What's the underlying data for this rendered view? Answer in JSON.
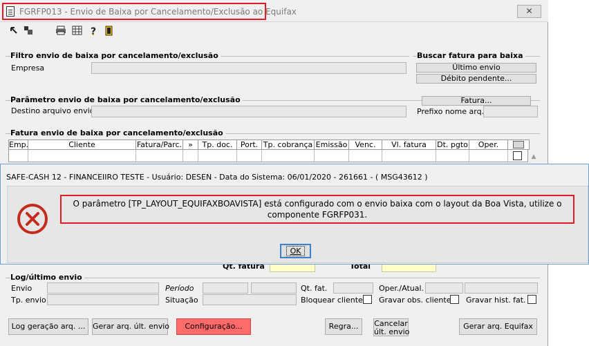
{
  "window": {
    "title": "FGRFP013 - Envio de Baixa por Cancelamento/Exclusão ao Equifax",
    "close_label": "✕"
  },
  "toolbar": {
    "icons": [
      "first-icon",
      "last-icon",
      "print-icon",
      "calculator-icon",
      "help-icon",
      "exit-icon"
    ]
  },
  "filtro": {
    "title": "Filtro envio de baixa por cancelamento/exclusão",
    "empresa_label": "Empresa",
    "empresa_value": ""
  },
  "buscar": {
    "title": "Buscar fatura para baixa",
    "ultimo_envio": "Último envio",
    "debito_pendente": "Débito pendente..."
  },
  "parametro": {
    "title": "Parâmetro envio de baixa por cancelamento/exclusão",
    "destino_label": "Destino arquivo envio",
    "fatura_button": "Fatura...",
    "prefixo_label": "Prefixo nome arq."
  },
  "fatura_grid": {
    "title": "Fatura envio de baixa por cancelamento/exclusão",
    "columns": [
      "Emp.",
      "Cliente",
      "Fatura/Parc.",
      "»",
      "Tp. doc.",
      "Port.",
      "Tp. cobrança",
      "Emissão",
      "Venc.",
      "Vl. fatura",
      "Dt. pgto",
      "Oper."
    ]
  },
  "totals": {
    "qt_fatura_label": "Qt. fatura",
    "total_label": "Total"
  },
  "log": {
    "title": "Log/último envio",
    "envio_label": "Envio",
    "tp_envio_label": "Tp. envio",
    "periodo_label": "Período",
    "situacao_label": "Situação",
    "qt_fat_label": "Qt. fat.",
    "bloquear_label": "Bloquear cliente",
    "oper_label": "Oper./Atual.",
    "gravar_obs_label": "Gravar obs. cliente",
    "gravar_hist_label": "Gravar hist. fat."
  },
  "buttons": {
    "log_geracao": "Log geração arq. ...",
    "gerar_ult": "Gerar arq. últ. envio",
    "configuracao": "Configuração...",
    "regra": "Regra...",
    "cancelar_line1": "Cancelar",
    "cancelar_line2": "últ. envio",
    "gerar_equifax": "Gerar arq. Equifax"
  },
  "dialog": {
    "title": "SAFE-CASH 12 - FINANCEIIRO TESTE - Usuário: DESEN - Data do Sistema: 06/01/2020 - 261661 - ( MSG43612 )",
    "message_line1": "O parâmetro [TP_LAYOUT_EQUIFAXBOAVISTA] está configurado com o envio baixa com o layout da Boa Vista, utilize o",
    "message_line2": "componente FGRFP031.",
    "ok_label": "OK"
  },
  "colors": {
    "highlight": "#e01b24",
    "config_button": "#ff6b6b",
    "yellow_field": "#ffffc8",
    "error_icon": "#c42b1c"
  }
}
